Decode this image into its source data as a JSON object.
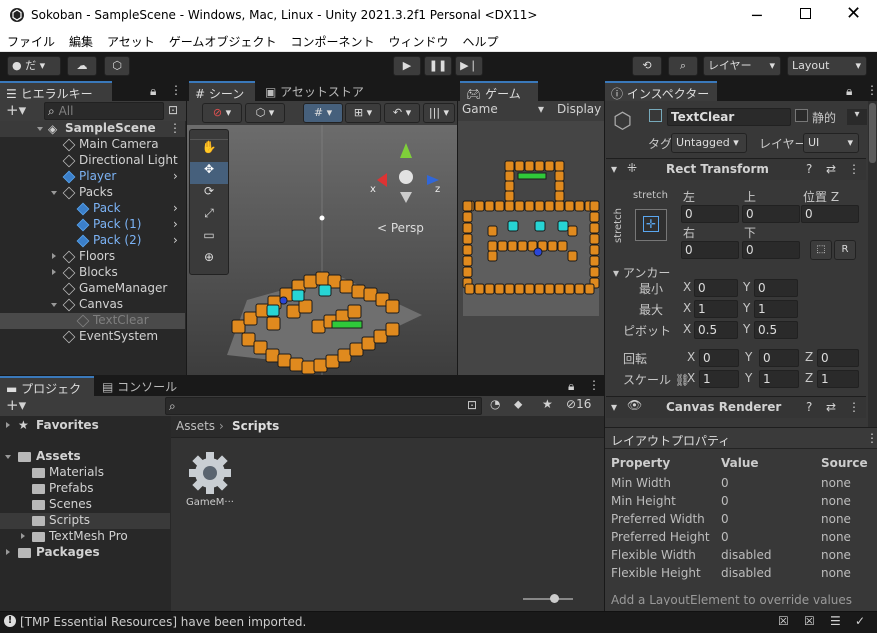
{
  "window": {
    "title": "Sokoban - SampleScene - Windows, Mac, Linux - Unity 2021.3.2f1 Personal <DX11>"
  },
  "menu": [
    "ファイル",
    "編集",
    "アセット",
    "ゲームオブジェクト",
    "コンポーネント",
    "ウィンドウ",
    "ヘルプ"
  ],
  "toolbar": {
    "account": "だ",
    "layers": "レイヤー",
    "layout": "Layout"
  },
  "hierarchy": {
    "tab": "ヒエラルキー",
    "search_placeholder": "All",
    "items": [
      {
        "label": "SampleScene",
        "depth": 0
      },
      {
        "label": "Main Camera",
        "depth": 1
      },
      {
        "label": "Directional Light",
        "depth": 1
      },
      {
        "label": "Player",
        "depth": 1
      },
      {
        "label": "Packs",
        "depth": 1
      },
      {
        "label": "Pack",
        "depth": 2
      },
      {
        "label": "Pack (1)",
        "depth": 2
      },
      {
        "label": "Pack (2)",
        "depth": 2
      },
      {
        "label": "Floors",
        "depth": 1
      },
      {
        "label": "Blocks",
        "depth": 1
      },
      {
        "label": "GameManager",
        "depth": 1
      },
      {
        "label": "Canvas",
        "depth": 1
      },
      {
        "label": "TextClear",
        "depth": 2
      },
      {
        "label": "EventSystem",
        "depth": 1
      }
    ]
  },
  "scene": {
    "tab_scene": "シーン",
    "tab_asset_store": "アセットストア",
    "persp": "Persp",
    "axis_x": "x",
    "axis_z": "z"
  },
  "game": {
    "tab": "ゲーム",
    "display_dropdown": "Game",
    "display_label": "Display"
  },
  "inspector": {
    "tab": "インスペクター",
    "object_name": "TextClear",
    "static_label": "静的",
    "tag_label": "タグ",
    "tag_value": "Untagged",
    "layer_label": "レイヤー",
    "layer_value": "UI",
    "rect_transform": {
      "title": "Rect Transform",
      "anchor_h": "stretch",
      "anchor_v": "stretch",
      "left_label": "左",
      "top_label": "上",
      "posz_label": "位置 Z",
      "left": "0",
      "top": "0",
      "posz": "0",
      "right_label": "右",
      "bottom_label": "下",
      "right": "0",
      "bottom": "0",
      "r_button": "R",
      "anchors_label": "アンカー",
      "min_label": "最小",
      "min_x": "0",
      "min_y": "0",
      "max_label": "最大",
      "max_x": "1",
      "max_y": "1",
      "pivot_label": "ピボット",
      "pivot_x": "0.5",
      "pivot_y": "0.5",
      "rotation_label": "回転",
      "rot_x": "0",
      "rot_y": "0",
      "rot_z": "0",
      "scale_label": "スケール",
      "scale_x": "1",
      "scale_y": "1",
      "scale_z": "1"
    },
    "canvas_renderer": {
      "title": "Canvas Renderer"
    }
  },
  "layout_props": {
    "title": "レイアウトプロパティ",
    "headers": [
      "Property",
      "Value",
      "Source"
    ],
    "rows": [
      [
        "Min Width",
        "0",
        "none"
      ],
      [
        "Min Height",
        "0",
        "none"
      ],
      [
        "Preferred Width",
        "0",
        "none"
      ],
      [
        "Preferred Height",
        "0",
        "none"
      ],
      [
        "Flexible Width",
        "disabled",
        "none"
      ],
      [
        "Flexible Height",
        "disabled",
        "none"
      ]
    ],
    "footer": "Add a LayoutElement to override values"
  },
  "project": {
    "tab_project": "プロジェクト",
    "tab_console": "コンソール",
    "hidden_count": "16",
    "favorites": "Favorites",
    "assets": "Assets",
    "folders": [
      "Materials",
      "Prefabs",
      "Scenes",
      "Scripts",
      "TextMesh Pro"
    ],
    "packages": "Packages",
    "breadcrumb_root": "Assets",
    "breadcrumb_current": "Scripts",
    "asset_item": "GameM···"
  },
  "status": {
    "message": "[TMP Essential Resources] have been imported."
  },
  "colors": {
    "accent": "#3a79bb",
    "selected_row": "#2c5d87",
    "panel": "#282828",
    "toolbar": "#191919",
    "block_orange": "#e08a1e",
    "pack_cyan": "#27d4d4",
    "goal_green": "#2fc93a"
  }
}
